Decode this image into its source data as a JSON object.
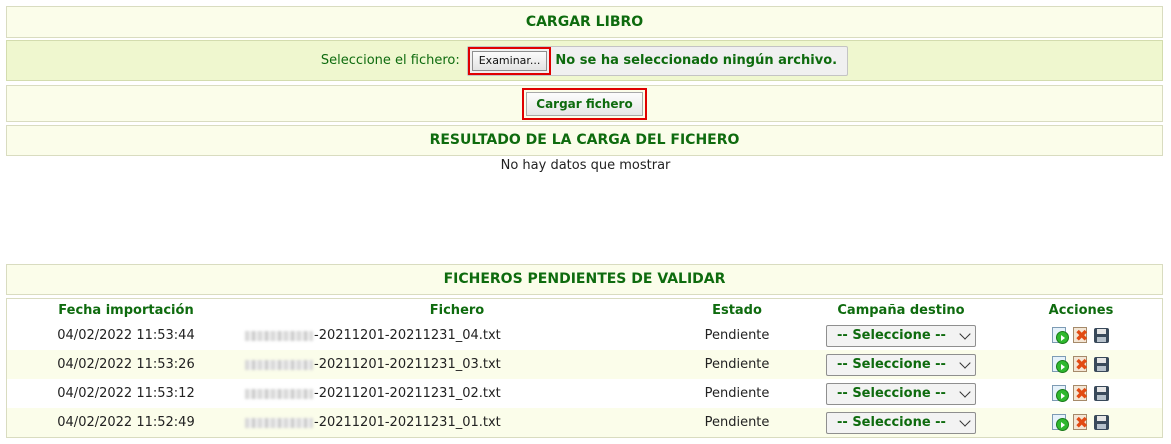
{
  "upload_section": {
    "title": "CARGAR LIBRO",
    "select_label": "Seleccione el fichero:",
    "browse_button": "Examinar...",
    "no_file_text": "No se ha seleccionado ningún archivo.",
    "upload_button": "Cargar fichero"
  },
  "result_section": {
    "title": "RESULTADO DE LA CARGA DEL FICHERO",
    "empty_message": "No hay datos que mostrar"
  },
  "pending_section": {
    "title": "FICHEROS PENDIENTES DE VALIDAR",
    "columns": [
      "Fecha importación",
      "Fichero",
      "Estado",
      "Campaña destino",
      "Acciones"
    ],
    "rows": [
      {
        "date": "04/02/2022 11:53:44",
        "file": "-20211201-20211231_04.txt",
        "status": "Pendiente",
        "campaign": "-- Seleccione --"
      },
      {
        "date": "04/02/2022 11:53:26",
        "file": "-20211201-20211231_03.txt",
        "status": "Pendiente",
        "campaign": "-- Seleccione --"
      },
      {
        "date": "04/02/2022 11:53:12",
        "file": "-20211201-20211231_02.txt",
        "status": "Pendiente",
        "campaign": "-- Seleccione --"
      },
      {
        "date": "04/02/2022 11:52:49",
        "file": "-20211201-20211231_01.txt",
        "status": "Pendiente",
        "campaign": "-- Seleccione --"
      }
    ]
  },
  "icons": {
    "validate": "validate-page-go-icon",
    "delete": "delete-page-icon",
    "save": "save-disk-icon"
  },
  "colors": {
    "accent_text": "#0e6b0e",
    "band_bg": "#fbfdea",
    "select_band_bg": "#eff7cf",
    "highlight_frame": "#e00000"
  }
}
